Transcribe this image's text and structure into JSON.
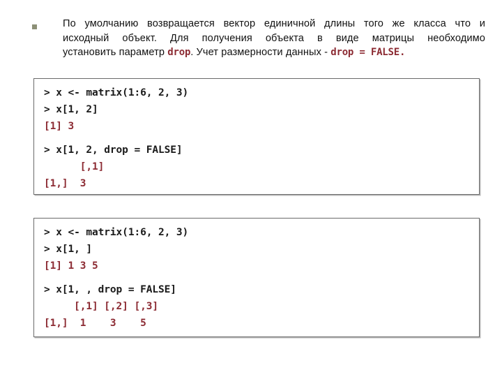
{
  "slide": {
    "bullet": {
      "marker_icon": "square-bullet-icon",
      "marker_color": "#8d9077",
      "lines": [
        {
          "segments": [
            {
              "kind": "plain",
              "text": "По умолчанию возвращается вектор единичной длины того же класса что и"
            }
          ]
        },
        {
          "segments": [
            {
              "kind": "plain",
              "text": "исходный объект. Для получения объекта в виде матрицы необходимо"
            }
          ]
        },
        {
          "segments": [
            {
              "kind": "plain",
              "text": "установить параметр "
            },
            {
              "kind": "code",
              "text": "drop"
            },
            {
              "kind": "plain",
              "text": ".  Учет размерности данных - "
            },
            {
              "kind": "code",
              "text": "drop = FALSE."
            }
          ]
        }
      ]
    },
    "code_blocks": [
      {
        "name": "r-console-example-1",
        "lines": [
          {
            "type": "input",
            "text": "> x <- matrix(1:6, 2, 3)",
            "gap": false
          },
          {
            "type": "input",
            "text": "> x[1, 2]",
            "gap": false
          },
          {
            "type": "output",
            "text": "[1] 3",
            "gap": false
          },
          {
            "type": "input",
            "text": "> x[1, 2, drop = FALSE]",
            "gap": true
          },
          {
            "type": "output",
            "text": "      [,1]",
            "gap": false
          },
          {
            "type": "output",
            "text": "[1,]  3",
            "gap": false
          }
        ]
      },
      {
        "name": "r-console-example-2",
        "lines": [
          {
            "type": "input",
            "text": "> x <- matrix(1:6, 2, 3)",
            "gap": false
          },
          {
            "type": "input",
            "text": "> x[1, ]",
            "gap": false
          },
          {
            "type": "output",
            "text": "[1] 1 3 5",
            "gap": false
          },
          {
            "type": "input",
            "text": "> x[1, , drop = FALSE]",
            "gap": true
          },
          {
            "type": "output",
            "text": "     [,1] [,2] [,3]",
            "gap": false
          },
          {
            "type": "output",
            "text": "[1,]  1    3    5",
            "gap": false
          }
        ]
      }
    ],
    "colors": {
      "code_text_output": "#8c2b33",
      "code_text_input": "#1a1a1a",
      "bullet_marker": "#8d9077",
      "block_border": "#6a6a6a",
      "background": "#ffffff"
    }
  }
}
